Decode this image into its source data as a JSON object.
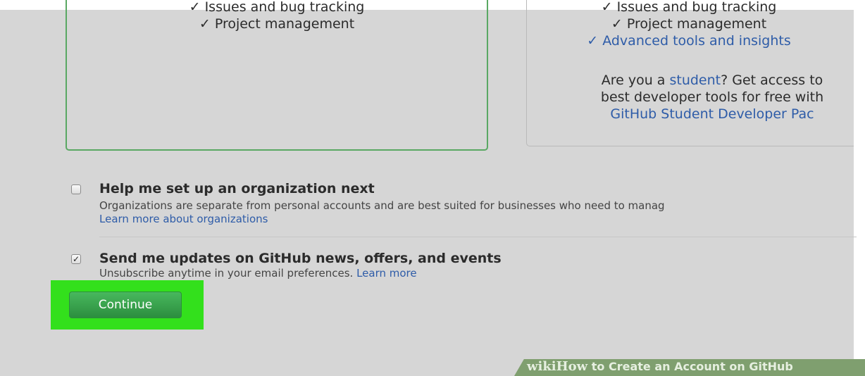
{
  "free_plan": {
    "features": [
      "✓ Issues and bug tracking",
      "✓ Project management"
    ]
  },
  "pro_plan": {
    "features": [
      "✓ Issues and bug tracking",
      "✓ Project management",
      "✓ Advanced tools and insights"
    ],
    "student_note": {
      "line1_prefix": "Are you a ",
      "student_link": "student",
      "line1_suffix": "? Get access to",
      "line2": "best developer tools for free with",
      "pack_link": "GitHub Student Developer Pac"
    }
  },
  "options": {
    "organization": {
      "checked": false,
      "title": "Help me set up an organization next",
      "description": "Organizations are separate from personal accounts and are best suited for businesses who need to manag",
      "link": "Learn more about organizations"
    },
    "updates": {
      "checked": true,
      "title": "Send me updates on GitHub news, offers, and events",
      "description": "Unsubscribe anytime in your email preferences.",
      "link": "Learn more"
    }
  },
  "continue_label": "Continue",
  "watermark": {
    "brand_prefix": "wiki",
    "brand_suffix": "How",
    "title": "to Create an Account on GitHub"
  },
  "colors": {
    "accent_green": "#2c8e3f",
    "highlight": "#33e01c",
    "link_blue": "#2e5ca8"
  }
}
